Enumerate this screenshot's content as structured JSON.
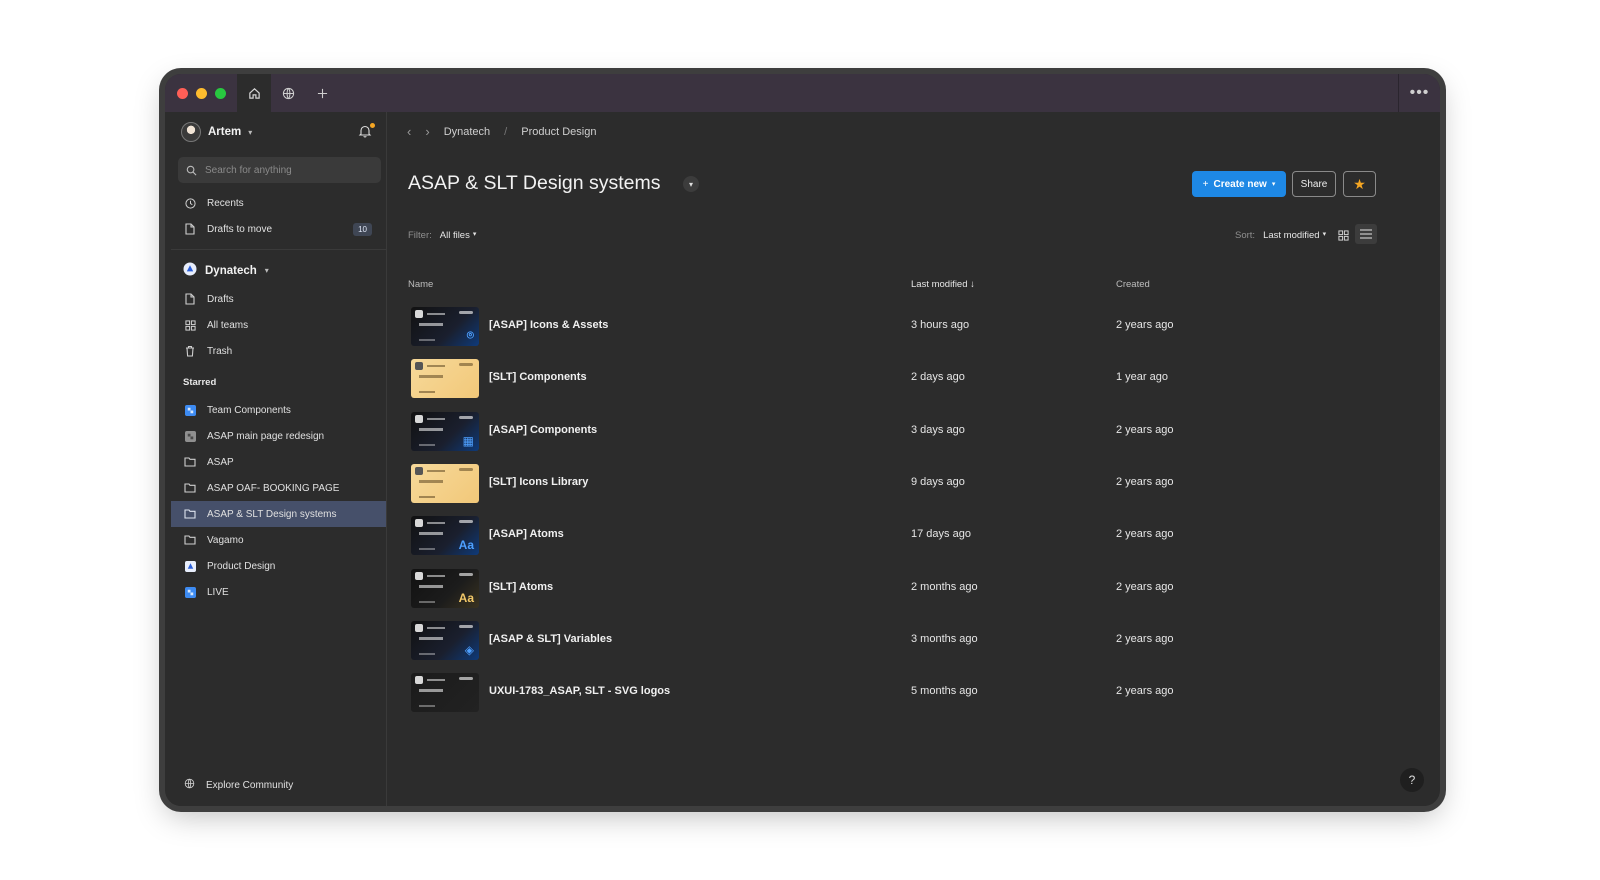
{
  "titlebar": {
    "icons": [
      "home-icon",
      "globe-icon",
      "plus-icon",
      "more-icon"
    ],
    "traffic_lights": {
      "close": "#ff5f57",
      "minimize": "#febc2e",
      "maximize": "#28c840"
    }
  },
  "sidebar": {
    "user_name": "Artem",
    "search_placeholder": "Search for anything",
    "recents_label": "Recents",
    "drafts_to_move_label": "Drafts to move",
    "drafts_to_move_count": "10",
    "team_name": "Dynatech",
    "team_items": [
      "Drafts",
      "All teams",
      "Trash"
    ],
    "starred_heading": "Starred",
    "starred": [
      {
        "label": "Team Components",
        "icon": "figma-file-blue-icon"
      },
      {
        "label": "ASAP main page redesign",
        "icon": "figma-file-icon"
      },
      {
        "label": "ASAP",
        "icon": "folder-icon"
      },
      {
        "label": "ASAP OAF- BOOKING PAGE",
        "icon": "folder-icon"
      },
      {
        "label": "ASAP & SLT Design systems",
        "icon": "folder-icon"
      },
      {
        "label": "Vagamo",
        "icon": "folder-icon"
      },
      {
        "label": "Product Design",
        "icon": "team-logo-icon"
      },
      {
        "label": "LIVE",
        "icon": "figma-file-blue-icon"
      }
    ],
    "explore_label": "Explore Community"
  },
  "main": {
    "breadcrumb": [
      "Dynatech",
      "Product Design"
    ],
    "title": "ASAP & SLT Design systems",
    "create_label": "Create new",
    "share_label": "Share",
    "filter_label": "Filter:",
    "filter_value": "All files",
    "sort_label": "Sort:",
    "sort_value": "Last modified",
    "columns": {
      "name": "Name",
      "modified": "Last modified",
      "created": "Created"
    },
    "files": [
      {
        "name": "[ASAP] Icons & Assets",
        "modified": "3 hours ago",
        "created": "2 years ago",
        "theme": "dark",
        "glyph": "⌾"
      },
      {
        "name": "[SLT] Components",
        "modified": "2 days ago",
        "created": "1 year ago",
        "theme": "light",
        "glyph": ""
      },
      {
        "name": "[ASAP] Components",
        "modified": "3 days ago",
        "created": "2 years ago",
        "theme": "dark",
        "glyph": "▦"
      },
      {
        "name": "[SLT] Icons Library",
        "modified": "9 days ago",
        "created": "2 years ago",
        "theme": "light",
        "glyph": ""
      },
      {
        "name": "[ASAP] Atoms",
        "modified": "17 days ago",
        "created": "2 years ago",
        "theme": "dark",
        "glyph": "Aa"
      },
      {
        "name": "[SLT] Atoms",
        "modified": "2 months ago",
        "created": "2 years ago",
        "theme": "dark-gold",
        "glyph": "Aa"
      },
      {
        "name": "[ASAP & SLT] Variables",
        "modified": "3 months ago",
        "created": "2 years ago",
        "theme": "dark",
        "glyph": "◈"
      },
      {
        "name": "UXUI-1783_ASAP, SLT - SVG logos",
        "modified": "5 months ago",
        "created": "2 years ago",
        "theme": "plain",
        "glyph": ""
      }
    ]
  },
  "help_label": "?"
}
